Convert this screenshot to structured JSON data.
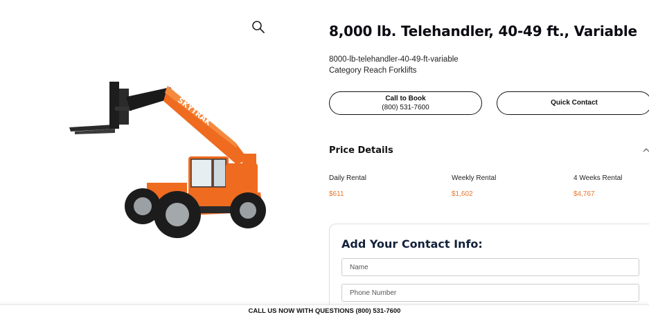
{
  "product": {
    "title": "8,000 lb. Telehandler, 40-49 ft., Variable",
    "sku": "8000-lb-telehandler-40-49-ft-variable",
    "category": "Category Reach Forklifts",
    "image_brand_text": "SKYTRAK"
  },
  "buttons": {
    "call_label": "Call to Book",
    "call_number": "(800) 531-7600",
    "quick_contact": "Quick Contact"
  },
  "price_details": {
    "heading": "Price Details",
    "items": [
      {
        "label": "Daily Rental",
        "value": "$611"
      },
      {
        "label": "Weekly Rental",
        "value": "$1,602"
      },
      {
        "label": "4 Weeks Rental",
        "value": "$4,767"
      }
    ]
  },
  "contact_form": {
    "title": "Add Your Contact Info:",
    "name_placeholder": "Name",
    "phone_placeholder": "Phone Number"
  },
  "footer": {
    "text": "CALL US NOW WITH QUESTIONS (800) 531-7600"
  },
  "colors": {
    "accent_price": "#e8742a",
    "machine_orange": "#ee6b1f",
    "heading_dark": "#14213a"
  },
  "icons": {
    "zoom": "magnifier-icon",
    "collapse": "chevron-up-icon"
  }
}
